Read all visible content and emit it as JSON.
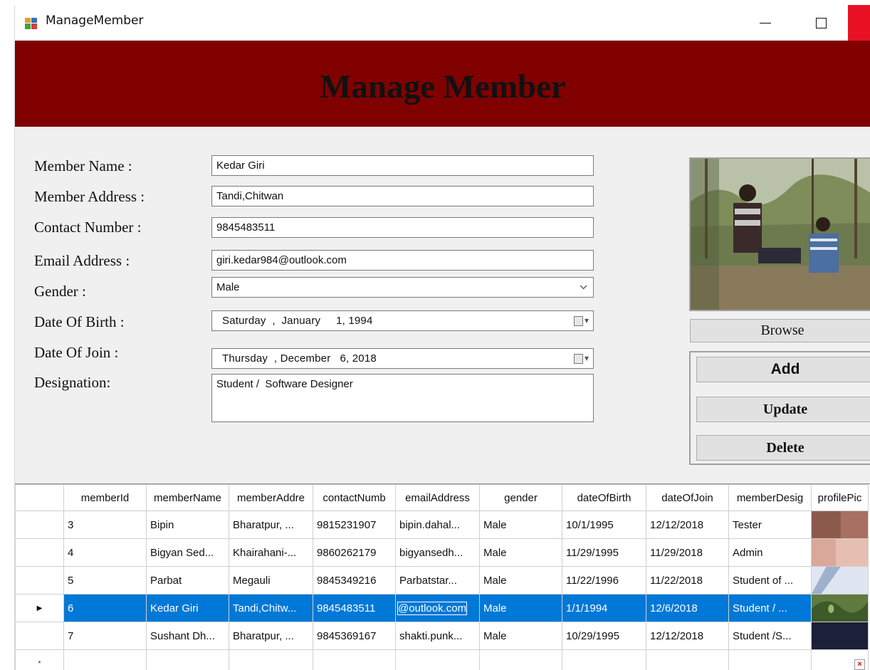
{
  "window": {
    "title": "ManageMember",
    "close_color": "#e81123"
  },
  "banner": {
    "heading": "Manage Member",
    "bg_color": "#800000"
  },
  "form": {
    "labels": {
      "name": "Member Name :",
      "address": "Member Address :",
      "contact": "Contact Number :",
      "email": "Email Address :",
      "gender": "Gender  :",
      "dob": "Date Of Birth :",
      "doj": "Date Of Join :",
      "designation": "Designation:"
    },
    "values": {
      "name": "Kedar Giri",
      "address": "Tandi,Chitwan",
      "contact": "9845483511",
      "email": "giri.kedar984@outlook.com",
      "gender": "Male",
      "dob": "Saturday  ,  January     1, 1994",
      "doj": "Thursday  , December   6, 2018",
      "designation": "Student /  Software Designer"
    }
  },
  "side": {
    "browse_label": "Browse",
    "add_label": "Add",
    "update_label": "Update",
    "delete_label": "Delete"
  },
  "grid": {
    "columns": [
      "memberId",
      "memberName",
      "memberAddre",
      "contactNumb",
      "emailAddress",
      "gender",
      "dateOfBirth",
      "dateOfJoin",
      "memberDesig",
      "profilePic"
    ],
    "rows": [
      [
        "3",
        "Bipin",
        "Bharatpur, ...",
        "9815231907",
        "bipin.dahal...",
        "Male",
        "10/1/1995",
        "12/12/2018",
        "Tester"
      ],
      [
        "4",
        "Bigyan Sed...",
        "Khairahani-...",
        "9860262179",
        "bigyansedh...",
        "Male",
        "11/29/1995",
        "11/29/2018",
        "Admin"
      ],
      [
        "5",
        "Parbat",
        "Megauli",
        "9845349216",
        "Parbatstar...",
        "Male",
        "11/22/1996",
        "11/22/2018",
        "Student of ..."
      ],
      [
        "6",
        "Kedar Giri",
        "Tandi,Chitw...",
        "9845483511",
        "@outlook.com",
        "Male",
        "1/1/1994",
        "12/6/2018",
        "Student / ..."
      ],
      [
        "7",
        "Sushant Dh...",
        "Bharatpur, ...",
        "9845369167",
        "shakti.punk...",
        "Male",
        "10/29/1995",
        "12/12/2018",
        "Student /S..."
      ]
    ],
    "selected_row_index": 3,
    "selection_color": "#0078d7",
    "current_row_marker": "▶",
    "new_row_marker": "*"
  }
}
